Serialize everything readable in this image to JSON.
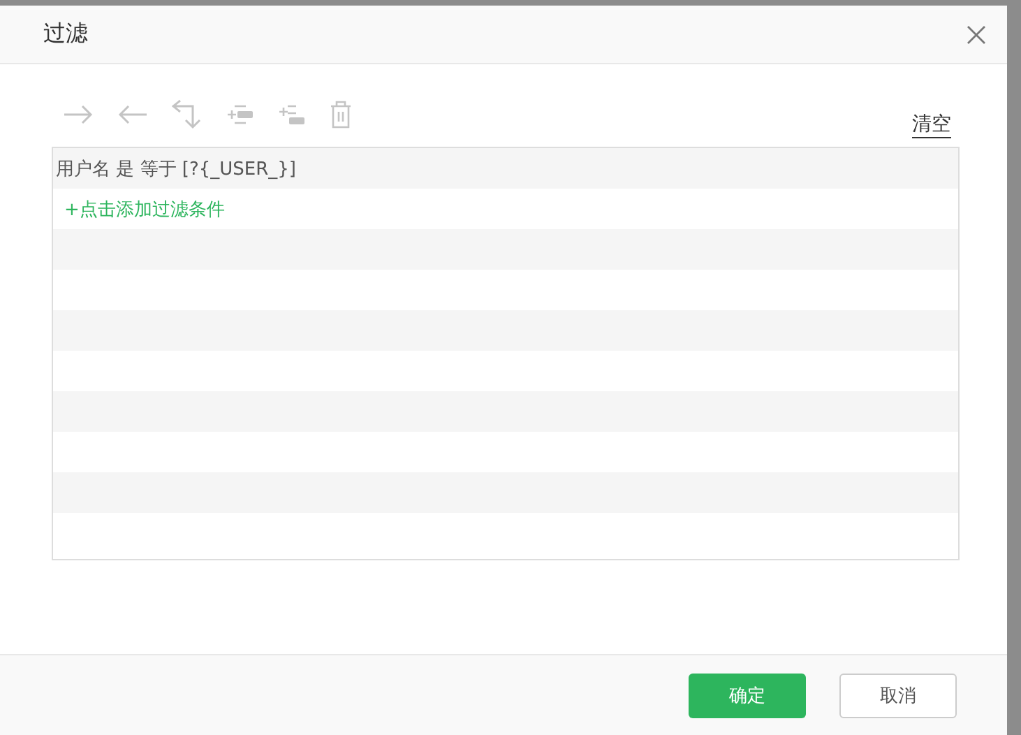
{
  "dialog": {
    "title": "过滤"
  },
  "toolbar": [
    {
      "kind": "indent",
      "disabled": true
    },
    {
      "kind": "outdent",
      "disabled": true
    },
    {
      "kind": "branch",
      "disabled": true
    },
    {
      "kind": "add-above",
      "disabled": true
    },
    {
      "kind": "add-below",
      "disabled": true
    },
    {
      "kind": "delete",
      "disabled": true
    }
  ],
  "clear_link": "清空",
  "conditions": [
    "用户名 是 等于 [?{_USER_}]"
  ],
  "add_condition_link": "+点击添加过滤条件",
  "buttons": [
    {
      "label": "确定",
      "kind": "primary"
    },
    {
      "label": "取消",
      "kind": "secondary"
    }
  ]
}
